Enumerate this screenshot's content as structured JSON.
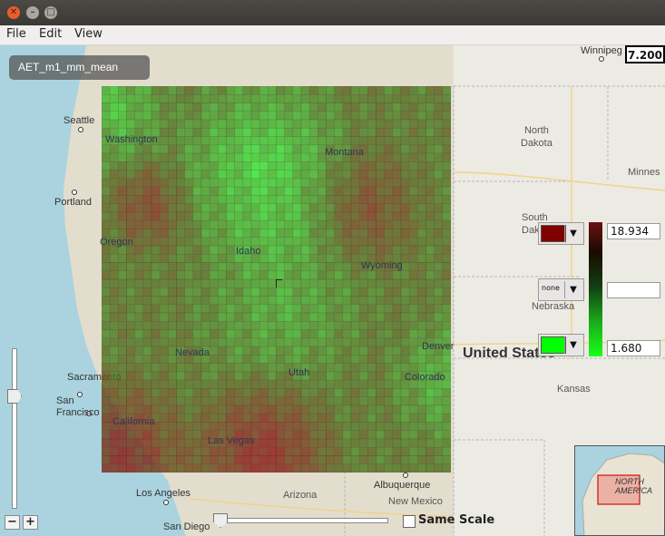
{
  "window": {
    "close_glyph": "✕",
    "min_glyph": "–",
    "max_glyph": "□"
  },
  "menu": {
    "file": "File",
    "edit": "Edit",
    "view": "View"
  },
  "layer": {
    "name": "AET_m1_mm_mean"
  },
  "scale_readout": "7.200",
  "legend": {
    "high_value": "18.934",
    "mid_value": "",
    "low_value": "1.680",
    "high_color": "#800000",
    "mid_option": "none",
    "low_color": "#00ff00",
    "dropdown_glyph": "▼"
  },
  "map_labels": {
    "cities": {
      "winnipeg": "Winnipeg",
      "seattle": "Seattle",
      "portland": "Portland",
      "sacramento": "Sacramento",
      "san_francisco": "San\nFrancisco",
      "los_angeles": "Los Angeles",
      "san_diego": "San Diego",
      "las_vegas": "Las Vegas",
      "denver": "Denver",
      "albuquerque": "Albuquerque"
    },
    "states": {
      "washington": "Washington",
      "oregon": "Oregon",
      "idaho": "Idaho",
      "montana": "Montana",
      "wyoming": "Wyoming",
      "nevada": "Nevada",
      "utah": "Utah",
      "colorado": "Colorado",
      "california": "California",
      "arizona": "Arizona",
      "new_mexico": "New Mexico",
      "north_dakota": "North\nDakota",
      "south_dakota": "South\nDak",
      "nebraska": "Nebraska",
      "kansas": "Kansas",
      "minnesota": "Minnes"
    },
    "country": "United States",
    "inset": "NORTH\nAMERICA"
  },
  "zoom": {
    "minus": "−",
    "plus": "+",
    "level_fraction": 0.7
  },
  "time_slider": {
    "position_fraction": 0.0
  },
  "same_scale": {
    "label": "Same Scale",
    "checked": false
  },
  "colors": {
    "heat_high": "#8a1a14",
    "heat_mid": "#4d6e1c",
    "heat_low": "#33e633"
  }
}
